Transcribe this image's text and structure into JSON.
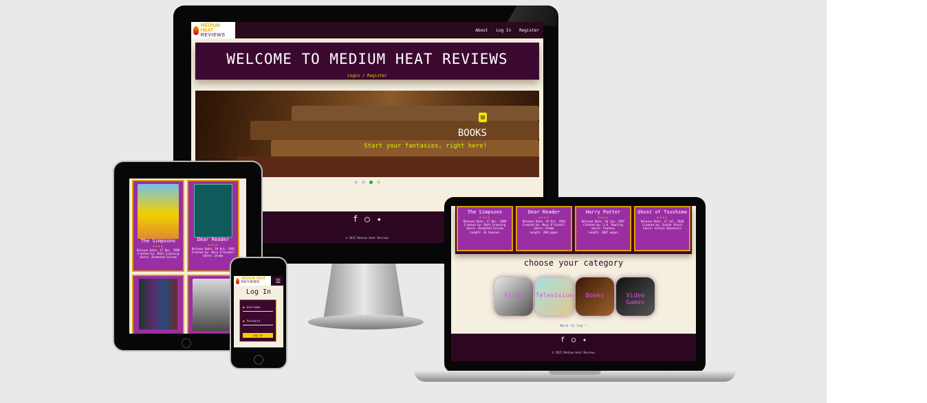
{
  "site": {
    "logo_top": "MEDIUM HEAT",
    "logo_bottom": "REVIEWS",
    "nav_links": [
      "About",
      "Log In",
      "Register"
    ],
    "welcome_title": "WELCOME TO MEDIUM HEAT REVIEWS",
    "welcome_sub": "Login / Register",
    "hero": {
      "icon": "book-icon",
      "title": "BOOKS",
      "subtitle": "Start your fantasies, right here!",
      "carousel_dots": 4,
      "active_dot": 3
    },
    "social_icons": [
      "facebook-icon",
      "instagram-icon",
      "twitter-icon"
    ],
    "copyright": "© 2022 Medium Heat Reviews"
  },
  "laptop": {
    "cards": [
      {
        "name": "The Simpsons",
        "stars": "★★★★",
        "info": [
          "Release Date: 17 Dec. 1989",
          "Created by: Matt Groening",
          "Genre: Animated Sitcom",
          "Length: 33 Seasons"
        ]
      },
      {
        "name": "Dear Reader",
        "stars": "★★★★",
        "info": [
          "Release Date: 19 Oct. 1991",
          "Created by: Mary O'Connell",
          "Genre: Drama",
          "Length: 288 pages"
        ]
      },
      {
        "name": "Harry Potter",
        "stars": "★★★★",
        "info": [
          "Release Date: 26 Jun. 1997",
          "Created by: J.K. Rowling",
          "Genre: Fantasy",
          "Length: 3407 pages"
        ]
      },
      {
        "name": "Ghost of Tsushima",
        "stars": "★★★★",
        "info": [
          "Release Date: 17 Jul. 2020",
          "Created by: Sucker Punch",
          "Genre: Action Adventure"
        ]
      }
    ],
    "category_heading": "choose your category",
    "categories": [
      "Films",
      "Television",
      "Books",
      "Video Games"
    ],
    "back_link": "Back to top ^"
  },
  "tablet": {
    "cards": [
      {
        "name": "The Simpsons",
        "stars": "★★★★",
        "info": [
          "Release Date: 17 Dec. 1989",
          "Created by: Matt Groening",
          "Genre: Animated Sitcom",
          "Length: 33 Seasons"
        ]
      },
      {
        "name": "Dear Reader",
        "stars": "★★★★",
        "info": [
          "Release Date: 19 Oct. 1991",
          "Created by: Mary O'Connell",
          "Genre: Drama",
          "Length: 288 pages"
        ]
      }
    ]
  },
  "phone": {
    "title": "Log In",
    "username_label": "Username",
    "password_label": "Password",
    "button": "Log In"
  }
}
